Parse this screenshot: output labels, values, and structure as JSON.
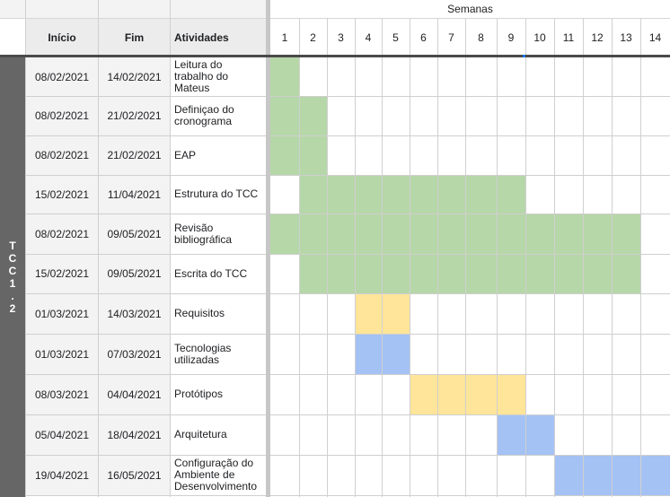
{
  "headers": {
    "start": "Início",
    "end": "Fim",
    "activities": "Atividades",
    "weeks": "Semanas"
  },
  "weeks": [
    "1",
    "2",
    "3",
    "4",
    "5",
    "6",
    "7",
    "8",
    "9",
    "10",
    "11",
    "12",
    "13",
    "14"
  ],
  "phase_label": "T\nC\nC\n1\n.\n2",
  "colors": {
    "green": "#b6d7a8",
    "yellow": "#ffe599",
    "blue": "#a4c2f4",
    "phase": "#666666"
  },
  "rows": [
    {
      "start": "08/02/2021",
      "end": "14/02/2021",
      "activity": "Leitura do\ntrabalho do\nMateus",
      "bar_start_week": 1,
      "bar_end_week": 1,
      "color": "green"
    },
    {
      "start": "08/02/2021",
      "end": "21/02/2021",
      "activity": "Definiçao do\ncronograma",
      "bar_start_week": 1,
      "bar_end_week": 2,
      "color": "green"
    },
    {
      "start": "08/02/2021",
      "end": "21/02/2021",
      "activity": "EAP",
      "bar_start_week": 1,
      "bar_end_week": 2,
      "color": "green"
    },
    {
      "start": "15/02/2021",
      "end": "11/04/2021",
      "activity": "Estrutura do TCC",
      "bar_start_week": 2,
      "bar_end_week": 9,
      "color": "green"
    },
    {
      "start": "08/02/2021",
      "end": "09/05/2021",
      "activity": "Revisão\nbibliográfica",
      "bar_start_week": 1,
      "bar_end_week": 13,
      "color": "green"
    },
    {
      "start": "15/02/2021",
      "end": "09/05/2021",
      "activity": "Escrita do TCC",
      "bar_start_week": 2,
      "bar_end_week": 13,
      "color": "green"
    },
    {
      "start": "01/03/2021",
      "end": "14/03/2021",
      "activity": "Requisitos",
      "bar_start_week": 4,
      "bar_end_week": 5,
      "color": "yellow"
    },
    {
      "start": "01/03/2021",
      "end": "07/03/2021",
      "activity": "Tecnologias\nutilizadas",
      "bar_start_week": 4,
      "bar_end_week": 5,
      "color": "blue"
    },
    {
      "start": "08/03/2021",
      "end": "04/04/2021",
      "activity": "Protótipos",
      "bar_start_week": 6,
      "bar_end_week": 9,
      "color": "yellow"
    },
    {
      "start": "05/04/2021",
      "end": "18/04/2021",
      "activity": "Arquitetura",
      "bar_start_week": 9,
      "bar_end_week": 10,
      "color": "blue"
    },
    {
      "start": "19/04/2021",
      "end": "16/05/2021",
      "activity": "Configuração do\nAmbiente de\nDesenvolvimento",
      "bar_start_week": 11,
      "bar_end_week": 14,
      "color": "blue"
    }
  ]
}
